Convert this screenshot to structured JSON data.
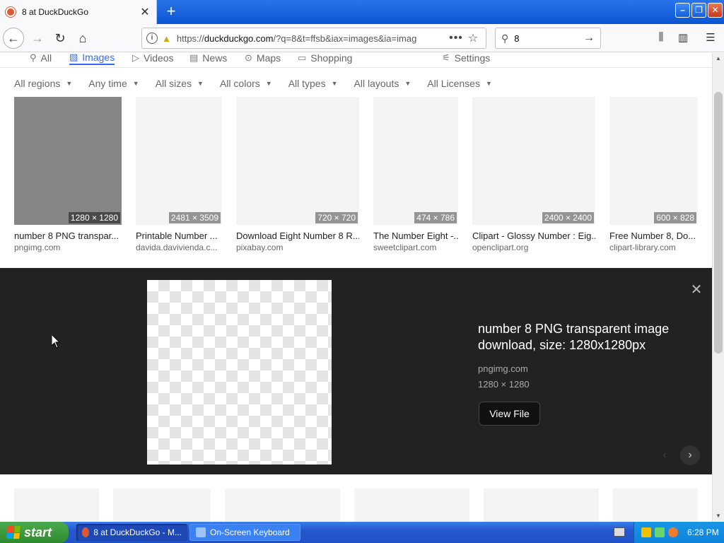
{
  "browser": {
    "tab_title": "8 at DuckDuckGo",
    "tab_close": "✕",
    "new_tab": "+",
    "url_host": "duckduckgo.com",
    "url_prefix": "https://",
    "url_rest": "/?q=8&t=ffsb&iax=images&ia=imag",
    "page_actions": "•••",
    "bookmark_star": "☆",
    "search_value": "8",
    "icons": {
      "back": "back-arrow-icon",
      "forward": "forward-arrow-icon",
      "reload": "reload-icon",
      "home": "home-icon",
      "library": "library-icon",
      "sidebar": "sidebar-icon",
      "menu": "hamburger-menu-icon"
    }
  },
  "nav_tabs": [
    {
      "label": "All",
      "icon": "search-icon",
      "active": false
    },
    {
      "label": "Images",
      "icon": "image-icon",
      "active": true
    },
    {
      "label": "Videos",
      "icon": "play-icon",
      "active": false
    },
    {
      "label": "News",
      "icon": "news-icon",
      "active": false
    },
    {
      "label": "Maps",
      "icon": "map-pin-icon",
      "active": false
    },
    {
      "label": "Shopping",
      "icon": "shopping-bag-icon",
      "active": false
    }
  ],
  "settings_label": "Settings",
  "filters": [
    "All regions",
    "Any time",
    "All sizes",
    "All colors",
    "All types",
    "All layouts",
    "All Licenses"
  ],
  "results": [
    {
      "caption": "number 8 PNG transpar...",
      "source": "pngimg.com",
      "dims": "1280 × 1280"
    },
    {
      "caption": "Printable Number ...",
      "source": "davida.davivienda.c...",
      "dims": "2481 × 3509"
    },
    {
      "caption": "Download Eight Number 8 R...",
      "source": "pixabay.com",
      "dims": "720 × 720"
    },
    {
      "caption": "The Number Eight -...",
      "source": "sweetclipart.com",
      "dims": "474 × 786"
    },
    {
      "caption": "Clipart - Glossy Number : Eig...",
      "source": "openclipart.org",
      "dims": "2400 × 2400"
    },
    {
      "caption": "Free Number 8, Do...",
      "source": "clipart-library.com",
      "dims": "600 × 828"
    }
  ],
  "detail": {
    "title": "number 8 PNG transparent image download, size: 1280x1280px",
    "source": "pngimg.com",
    "size": "1280 × 1280",
    "view_file": "View File",
    "close": "✕",
    "prev": "‹",
    "next": "›"
  },
  "taskbar": {
    "start": "start",
    "tasks": [
      "8 at DuckDuckGo - M...",
      "On-Screen Keyboard"
    ],
    "clock": "6:28 PM"
  },
  "colors": {
    "accent": "#3969ef",
    "detail_bg": "#222222",
    "xp_blue": "#2457d0",
    "xp_green": "#3c9a3c"
  }
}
